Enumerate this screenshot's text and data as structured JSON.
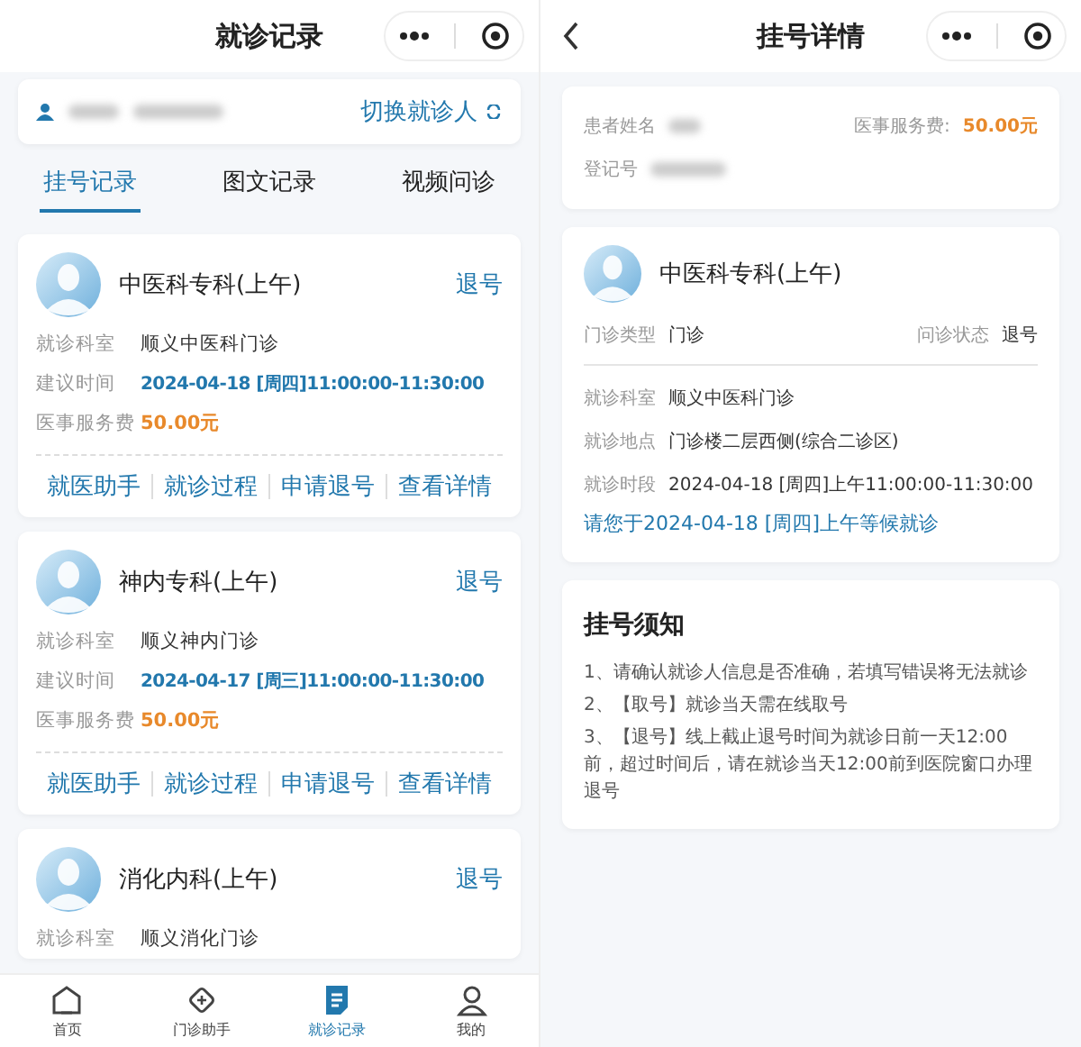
{
  "left": {
    "title": "就诊记录",
    "patient_bar": {
      "switch_label": "切换就诊人"
    },
    "tabs": [
      {
        "label": "挂号记录",
        "selected": true
      },
      {
        "label": "图文记录",
        "selected": false
      },
      {
        "label": "视频问诊",
        "selected": false
      }
    ],
    "records": [
      {
        "department": "中医科专科(上午)",
        "status": "退号",
        "fields": [
          {
            "label": "就诊科室",
            "value": "顺义中医科门诊",
            "kind": "plain"
          },
          {
            "label": "建议时间",
            "value": "2024-04-18 [周四]11:00:00-11:30:00",
            "kind": "time"
          },
          {
            "label": "医事服务费",
            "value": "50.00元",
            "kind": "fee"
          }
        ],
        "actions": [
          "就医助手",
          "就诊过程",
          "申请退号",
          "查看详情"
        ]
      },
      {
        "department": "神内专科(上午)",
        "status": "退号",
        "fields": [
          {
            "label": "就诊科室",
            "value": "顺义神内门诊",
            "kind": "plain"
          },
          {
            "label": "建议时间",
            "value": "2024-04-17 [周三]11:00:00-11:30:00",
            "kind": "time"
          },
          {
            "label": "医事服务费",
            "value": "50.00元",
            "kind": "fee"
          }
        ],
        "actions": [
          "就医助手",
          "就诊过程",
          "申请退号",
          "查看详情"
        ]
      },
      {
        "department": "消化内科(上午)",
        "status": "退号",
        "fields": [
          {
            "label": "就诊科室",
            "value": "顺义消化门诊",
            "kind": "plain"
          }
        ]
      }
    ],
    "nav": [
      {
        "label": "首页",
        "selected": false
      },
      {
        "label": "门诊助手",
        "selected": false
      },
      {
        "label": "就诊记录",
        "selected": true
      },
      {
        "label": "我的",
        "selected": false
      }
    ]
  },
  "right": {
    "title": "挂号详情",
    "patient_card": {
      "name_label": "患者姓名",
      "fee_label": "医事服务费:",
      "fee": "50.00元",
      "id_label": "登记号"
    },
    "detail": {
      "department": "中医科专科(上午)",
      "type_label": "门诊类型",
      "type_value": "门诊",
      "status_label": "问诊状态",
      "status_value": "退号",
      "fields": [
        {
          "label": "就诊科室",
          "value": "顺义中医科门诊"
        },
        {
          "label": "就诊地点",
          "value": "门诊楼二层西侧(综合二诊区)"
        },
        {
          "label": "就诊时段",
          "value": "2024-04-18 [周四]上午11:00:00-11:30:00"
        }
      ],
      "notice": "请您于2024-04-18 [周四]上午等候就诊"
    },
    "notice_card": {
      "title": "挂号须知",
      "items": [
        "1、请确认就诊人信息是否准确，若填写错误将无法就诊",
        "2、【取号】就诊当天需在线取号",
        "3、【退号】线上截止退号时间为就诊日前一天12:00前，超过时间后，请在就诊当天12:00前到医院窗口办理退号"
      ]
    }
  }
}
